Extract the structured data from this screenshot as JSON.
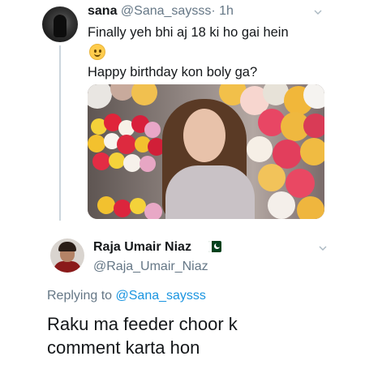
{
  "tweet": {
    "display_name": "sana",
    "handle": "@Sana_saysss",
    "separator": "·",
    "time": "1h",
    "text_line1": "Finally yeh bhi aj 18 ki ho gai hein",
    "emoji": "slightly-smiling-face",
    "text_line2": "Happy birthday kon boly ga?"
  },
  "reply": {
    "display_name": "Raja Umair Niaz",
    "flag": "pakistan-flag",
    "handle": "@Raja_Umair_Niaz",
    "replying_prefix": "Replying to",
    "replying_to": "@Sana_saysss",
    "text_line1": "Raku ma feeder choor k",
    "text_line2": "comment karta hon"
  },
  "colors": {
    "primary_text": "#14171a",
    "secondary_text": "#657786",
    "link": "#1b95e0",
    "thread_line": "#ccd6dd"
  }
}
